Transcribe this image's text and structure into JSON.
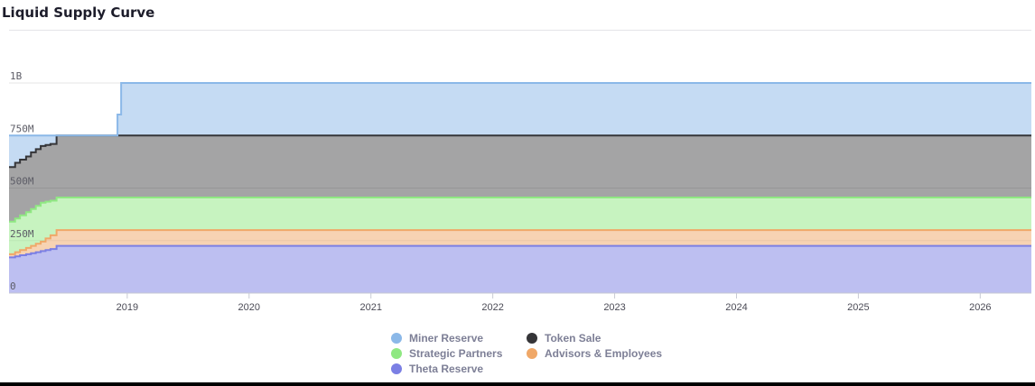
{
  "header": {
    "title": "Liquid Supply Curve"
  },
  "chart_data": {
    "type": "area",
    "stacked": true,
    "xlim": [
      2018.03,
      2026.42
    ],
    "ylim": [
      0,
      1000
    ],
    "y_ticks": [
      {
        "value": 0,
        "label": "0"
      },
      {
        "value": 250,
        "label": "250M"
      },
      {
        "value": 500,
        "label": "500M"
      },
      {
        "value": 750,
        "label": "750M"
      },
      {
        "value": 1000,
        "label": "1B"
      }
    ],
    "x_ticks": [
      {
        "value": 2019,
        "label": "2019"
      },
      {
        "value": 2020,
        "label": "2020"
      },
      {
        "value": 2021,
        "label": "2021"
      },
      {
        "value": 2022,
        "label": "2022"
      },
      {
        "value": 2023,
        "label": "2023"
      },
      {
        "value": 2024,
        "label": "2024"
      },
      {
        "value": 2025,
        "label": "2025"
      },
      {
        "value": 2026,
        "label": "2026"
      }
    ],
    "grid": true,
    "legend_position": "bottom-center",
    "step_dates": [
      2018.03,
      2018.08,
      2018.12,
      2018.17,
      2018.21,
      2018.25,
      2018.29,
      2018.33,
      2018.37,
      2018.42
    ],
    "series": [
      {
        "name": "Theta Reserve",
        "color": "#7b7fe4",
        "values": [
          170,
          175,
          180,
          185,
          190,
          195,
          200,
          205,
          210,
          225
        ]
      },
      {
        "name": "Advisors & Employees",
        "color": "#f0a868",
        "values": [
          15,
          20,
          25,
          30,
          35,
          40,
          45,
          55,
          65,
          75
        ]
      },
      {
        "name": "Strategic Partners",
        "color": "#8fe882",
        "values": [
          155,
          160,
          165,
          170,
          175,
          180,
          185,
          175,
          165,
          155
        ]
      },
      {
        "name": "Token Sale",
        "color": "#353538",
        "values": [
          260,
          265,
          265,
          265,
          270,
          270,
          270,
          270,
          270,
          295
        ]
      },
      {
        "name": "Miner Reserve",
        "color": "#8bb8e8",
        "step_dates": [
          2018.03,
          2018.92,
          2018.95
        ],
        "values": [
          0,
          100,
          250
        ]
      }
    ],
    "x_end": 2026.42
  },
  "legend": {
    "items": [
      {
        "name": "Miner Reserve",
        "color": "#8bb8e8"
      },
      {
        "name": "Token Sale",
        "color": "#353538"
      },
      {
        "name": "Strategic Partners",
        "color": "#8fe882"
      },
      {
        "name": "Advisors & Employees",
        "color": "#f0a868"
      },
      {
        "name": "Theta Reserve",
        "color": "#7b7fe4"
      }
    ]
  }
}
